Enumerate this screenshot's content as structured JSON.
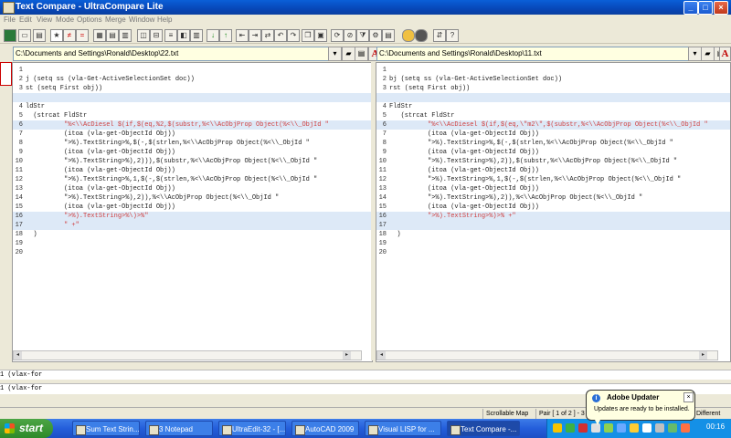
{
  "window": {
    "title": "Text Compare - UltraCompare Lite"
  },
  "menu": [
    "File",
    "Edit",
    "View",
    "Mode",
    "Options",
    "Merge",
    "Window",
    "Help"
  ],
  "paths": {
    "left": "C:\\Documents and Settings\\Ronald\\Desktop\\22.txt",
    "right": "C:\\Documents and Settings\\Ronald\\Desktop\\11.txt"
  },
  "left": {
    "lines": [
      {
        "n": "1",
        "t": ""
      },
      {
        "n": "2",
        "t": "j (setq ss (vla-Get-ActiveSelectionSet doc))"
      },
      {
        "n": "3",
        "t": "st (setq First obj))"
      },
      {
        "n": "",
        "t": "",
        "d": true
      },
      {
        "n": "4",
        "t": "ldStr"
      },
      {
        "n": "5",
        "t": "  (strcat FldStr"
      },
      {
        "n": "6",
        "t": "          \"%<\\\\AcDiesel $(if,$(eq,%2,$(substr,%<\\\\AcObjProp Object(%<\\\\_ObjId \"",
        "d": true,
        "r": true
      },
      {
        "n": "7",
        "t": "          (itoa (vla-get-ObjectId Obj))"
      },
      {
        "n": "8",
        "t": "          \">%).TextString>%,$(-,$(strlen,%<\\\\AcObjProp Object(%<\\\\_ObjId \""
      },
      {
        "n": "9",
        "t": "          (itoa (vla-get-ObjectId Obj))"
      },
      {
        "n": "10",
        "t": "          \">%).TextString>%),2))),$(substr,%<\\\\AcObjProp Object(%<\\\\_ObjId \""
      },
      {
        "n": "11",
        "t": "          (itoa (vla-get-ObjectId Obj))"
      },
      {
        "n": "12",
        "t": "          \">%).TextString>%,1,$(-,$(strlen,%<\\\\AcObjProp Object(%<\\\\_ObjId \""
      },
      {
        "n": "13",
        "t": "          (itoa (vla-get-ObjectId Obj))"
      },
      {
        "n": "14",
        "t": "          \">%).TextString>%),2)),%<\\\\AcObjProp Object(%<\\\\_ObjId \""
      },
      {
        "n": "15",
        "t": "          (itoa (vla-get-ObjectId Obj))"
      },
      {
        "n": "16",
        "t": "          \">%).TextString>%\\)>%\"",
        "d": true,
        "r": true
      },
      {
        "n": "17",
        "t": "          \" +\"",
        "d": true,
        "r": true
      },
      {
        "n": "18",
        "t": "  )"
      },
      {
        "n": "19",
        "t": ""
      },
      {
        "n": "20",
        "t": ""
      }
    ]
  },
  "right": {
    "lines": [
      {
        "n": "1",
        "t": ""
      },
      {
        "n": "2",
        "t": "bj (setq ss (vla-Get-ActiveSelectionSet doc))"
      },
      {
        "n": "3",
        "t": "rst (setq First obj))"
      },
      {
        "n": "",
        "t": "",
        "d": true
      },
      {
        "n": "4",
        "t": "FldStr"
      },
      {
        "n": "5",
        "t": "   (strcat FldStr"
      },
      {
        "n": "6",
        "t": "          \"%<\\\\AcDiesel $(if,$(eq,\\\"m2\\\",$(substr,%<\\\\AcObjProp Object(%<\\\\_ObjId \"",
        "d": true,
        "r": true
      },
      {
        "n": "7",
        "t": "          (itoa (vla-get-ObjectId Obj))"
      },
      {
        "n": "8",
        "t": "          \">%).TextString>%,$(-,$(strlen,%<\\\\AcObjProp Object(%<\\\\_ObjId \""
      },
      {
        "n": "9",
        "t": "          (itoa (vla-get-ObjectId Obj))"
      },
      {
        "n": "10",
        "t": "          \">%).TextString>%),2)),$(substr,%<\\\\AcObjProp Object(%<\\\\_ObjId \""
      },
      {
        "n": "11",
        "t": "          (itoa (vla-get-ObjectId Obj))"
      },
      {
        "n": "12",
        "t": "          \">%).TextString>%,1,$(-,$(strlen,%<\\\\AcObjProp Object(%<\\\\_ObjId \""
      },
      {
        "n": "13",
        "t": "          (itoa (vla-get-ObjectId Obj))"
      },
      {
        "n": "14",
        "t": "          \">%).TextString>%),2)),%<\\\\AcObjProp Object(%<\\\\_ObjId \""
      },
      {
        "n": "15",
        "t": "          (itoa (vla-get-ObjectId Obj))"
      },
      {
        "n": "16",
        "t": "          \">%).TextString>%)>% +\"",
        "d": true,
        "r": true
      },
      {
        "n": "17",
        "t": "",
        "d": true
      },
      {
        "n": "18",
        "t": "  )"
      },
      {
        "n": "19",
        "t": ""
      },
      {
        "n": "20",
        "t": ""
      }
    ]
  },
  "bottom": {
    "line1": "1  (vlax-for",
    "line2": "1  (vlax-for"
  },
  "status": {
    "map": "Scrollable Map",
    "pair": "Pair [ 1 of 2 ] - 3 Bl",
    "diff": "Different"
  },
  "taskbar": {
    "start": "start",
    "tasks": [
      "Sum Text Strin...",
      "3 Notepad",
      "UltraEdit-32 - [...",
      "AutoCAD 2009",
      "Visual LISP for ...",
      "Text Compare -..."
    ],
    "clock": "00:16"
  },
  "balloon": {
    "title": "Adobe Updater",
    "body": "Updates are ready to be installed.",
    "close": "×"
  },
  "colors": {
    "diff_bg": "#dde9f7",
    "diff_text": "#d04040",
    "titlebar": "#0747b8"
  }
}
